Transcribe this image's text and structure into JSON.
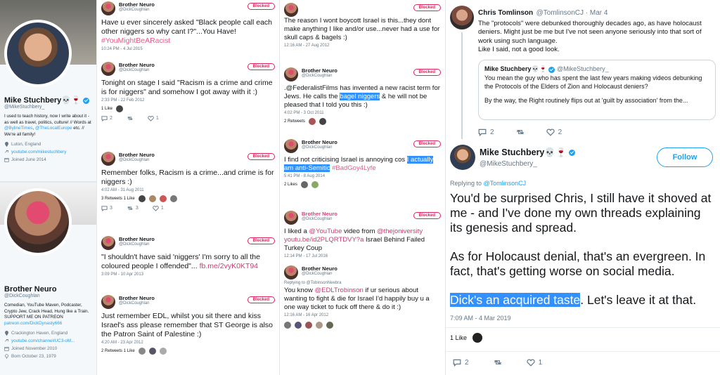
{
  "profiles": [
    {
      "name": "Mike Stuchbery💀🍷",
      "handle": "@MikeStuchbery_",
      "bio": "I used to teach history, now I write about it - as well as travel, politics, culture! // Words at",
      "bio_link1": "@BylineTimes",
      "bio_mid": ", ",
      "bio_link2": "@TheLocalEurope",
      "bio_end": " etc. // We're all family!",
      "location": "Luton, England",
      "website": "youtube.com/mikestuchbery",
      "joined": "Joined June 2014"
    },
    {
      "name": "Brother Neuro",
      "handle": "@DickCoughlan",
      "bio": "Comedian, YouTube Maven, Podcaster, Crypto Jew, Crack Head, Hung like a Train. SUPPORT ME ON PATREON",
      "bio_link": "patreon.com/DickDynasty666",
      "location": "Crackington Haven, England",
      "website": "youtube.com/channel/UC3-oM...",
      "joined": "Joined November 2010",
      "born": "Born October 23, 1979"
    }
  ],
  "blocked_label": "Blocked",
  "col_b": [
    {
      "name": "Brother Neuro",
      "handle": "@DickCoughlan",
      "text": "Have u ever sincerely asked \"Black people call each other niggers so why cant I?\"...You Have!",
      "hashtag": "#YouMightBeARacist",
      "time": "10:24 PM - 4 Jul 2015"
    },
    {
      "name": "Brother Neuro",
      "handle": "@DickCoughlan",
      "text": "Tonight on stage I said \"Racism is a crime and crime is for niggers\" and somehow I got away with it :)",
      "time": "2:33 PM - 22 Feb 2012",
      "stats": "1 Like",
      "acts": [
        "2",
        "",
        "1"
      ]
    },
    {
      "name": "Brother Neuro",
      "handle": "@DickCoughlan",
      "text": "Remember folks, Racism is a crime...and crime is for niggers :)",
      "time": "4:02 AM - 31 Aug 2011",
      "stats": "3 Retweets  1 Like",
      "acts": [
        "3",
        "3",
        "1"
      ]
    },
    {
      "name": "Brother Neuro",
      "handle": "@DickCoughlan",
      "text": "\"I shouldn't have said 'niggers' I'm sorry to all the coloured people I offended\"...",
      "link": "fb.me/2vyK0KT94",
      "time": "3:09 PM - 10 Apr 2013"
    },
    {
      "name": "Brother Neuro",
      "handle": "@DickCoughlan",
      "text": "Just remember EDL, whilst you sit there and kiss Israel's ass please remember that ST George is also the Patron Saint of Palestine :)",
      "time": "4:20 AM - 23 Apr 2012",
      "stats": "2 Retweets  1 Like"
    }
  ],
  "col_c": [
    {
      "text": "The reason I wont boycott Israel is this...they dont make anything I like and/or use...never had a use for skull caps & bagels :)",
      "time": "12:16 AM - 27 Aug 2012"
    },
    {
      "name": "Brother Neuro",
      "handle": "@DickCoughlan",
      "text_a": ".@FederalistFilms has invented a new racist term for Jews. He calls the ",
      "text_sel": "bagel niggers",
      "text_b": " & he will not be pleased that I told you this :)",
      "time": "4:02 PM - 3 Oct 2011",
      "stats": "2 Retweets"
    },
    {
      "name": "Brother Neuro",
      "handle": "@DickCoughlan",
      "text_a": "I find not criticising Israel is annoying cos ",
      "text_sel": "I actually am anti-Semitic",
      "hashtag": "#BadGoy4Lyfe",
      "time": "5:41 PM - 8 Aug 2014",
      "stats": "2 Likes"
    },
    {
      "name": "Brother Neuro",
      "handle": "@DickCoughlan",
      "text_a": "I liked a ",
      "link1": "@YouTube",
      "text_b": " video from ",
      "link2": "@thejoniversity youtu.be/id2PLQRTDVY?a",
      "text_c": " Israel Behind Failed Turkey Coup",
      "time": "12:14 PM - 17 Jul 2016"
    },
    {
      "name": "Brother Neuro",
      "handle": "@DickCoughlan",
      "replying": "Replying to @TobinsonNeebra",
      "text_a": "You know ",
      "link1": "@EDLTrobinson",
      "text_b": " if ur serious about wanting to fight & die for Israel I'd happily buy u a one way ticket to fuck off there & do it :)",
      "time": "12:16 AM - 16 Apr 2012"
    }
  ],
  "col_d": {
    "chris": {
      "name": "Chris Tomlinson",
      "handle": "@TomlinsonCJ · Mar 4",
      "text": "The \"protocols\" were debunked thoroughly decades ago, as have holocaust deniers. Might just be me but I've not seen anyone seriously into that sort of work using such language.\nLike I said, not a good look.",
      "quote_name": "Mike Stuchbery💀🍷",
      "quote_handle": "@MikeStuchbery_",
      "quote_text1": "You mean the guy who has spent the last few years making videos debunking the Protocols of the Elders of Zion and Holocaust deniers?",
      "quote_text2": "By the way, the Right routinely flips out at 'guilt by association' from the...",
      "acts": [
        "2",
        "",
        "2"
      ]
    },
    "mike": {
      "name": "Mike Stuchbery💀🍷",
      "handle": "@MikeStuchbery_",
      "follow": "Follow",
      "replying_prefix": "Replying to ",
      "replying_to": "@TomlinsonCJ",
      "p1": "You'd be surprised Chris, I still have it shoved at me - and I've done my own threads explaining its genesis and spread.",
      "p2": "As for Holocaust denial, that's an evergreen. In fact, that's getting worse on social media.",
      "p3_sel": "Dick's an acquired taste",
      "p3_rest": ". Let's leave it at that.",
      "time": "7:09 AM - 4 Mar 2019",
      "likes": "1 Like",
      "acts": [
        "2",
        "",
        "1"
      ]
    }
  }
}
